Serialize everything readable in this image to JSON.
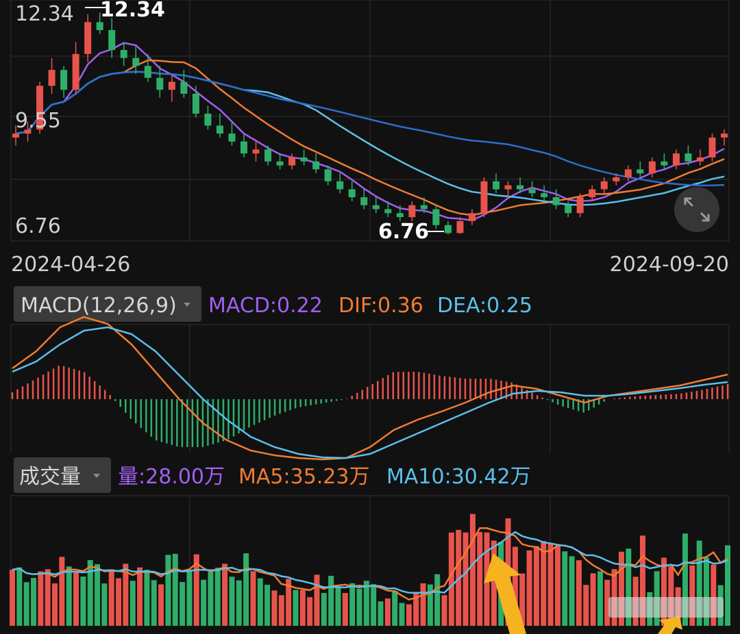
{
  "colors": {
    "background": "#111111",
    "grid": "#2e2e2e",
    "up": "#e8544c",
    "down": "#2fae6a",
    "ma_purple": "#a25ff0",
    "ma_orange": "#f07c32",
    "ma_lightblue": "#5bc0eb",
    "ma_blue": "#2a6fcf",
    "arrow": "#f5b31f",
    "label": "#d0d0d0"
  },
  "price_panel": {
    "y_labels": [
      "12.34",
      "9.55",
      "6.76"
    ],
    "max_marker": "12.34",
    "min_marker": "6.76",
    "date_start": "2024-04-26",
    "date_end": "2024-09-20",
    "expand_icon": "expand-arrows-icon"
  },
  "macd_panel": {
    "selector_label": "MACD(12,26,9)",
    "macd_text": "MACD:0.22",
    "dif_text": "DIF:0.36",
    "dea_text": "DEA:0.25"
  },
  "volume_panel": {
    "selector_label": "成交量",
    "vol_text": "量:28.00万",
    "ma5_text": "MA5:35.23万",
    "ma10_text": "MA10:30.42万"
  },
  "chart_data": [
    {
      "type": "candlestick",
      "title": "",
      "x_range": [
        "2024-04-26",
        "2024-09-20"
      ],
      "ylim": [
        6.76,
        12.34
      ],
      "high": 12.34,
      "low": 6.76,
      "ohlc": [
        [
          9.2,
          9.5,
          9.0,
          9.3
        ],
        [
          9.3,
          9.6,
          9.1,
          9.4
        ],
        [
          9.4,
          10.6,
          9.3,
          10.5
        ],
        [
          10.5,
          11.2,
          10.3,
          10.9
        ],
        [
          10.9,
          11.0,
          10.2,
          10.4
        ],
        [
          10.4,
          11.6,
          10.3,
          11.3
        ],
        [
          11.3,
          12.3,
          11.1,
          12.1
        ],
        [
          12.1,
          12.34,
          11.8,
          11.9
        ],
        [
          11.9,
          12.2,
          11.2,
          11.4
        ],
        [
          11.4,
          11.6,
          11.0,
          11.2
        ],
        [
          11.2,
          11.5,
          10.8,
          11.0
        ],
        [
          11.0,
          11.3,
          10.6,
          10.7
        ],
        [
          10.7,
          11.0,
          10.2,
          10.4
        ],
        [
          10.4,
          10.8,
          10.1,
          10.6
        ],
        [
          10.6,
          10.9,
          10.2,
          10.3
        ],
        [
          10.3,
          10.5,
          9.7,
          9.8
        ],
        [
          9.8,
          10.0,
          9.4,
          9.5
        ],
        [
          9.5,
          9.8,
          9.2,
          9.3
        ],
        [
          9.3,
          9.6,
          9.0,
          9.1
        ],
        [
          9.1,
          9.3,
          8.7,
          8.8
        ],
        [
          8.8,
          9.1,
          8.6,
          8.9
        ],
        [
          8.9,
          9.0,
          8.5,
          8.6
        ],
        [
          8.6,
          8.8,
          8.4,
          8.5
        ],
        [
          8.5,
          8.8,
          8.4,
          8.7
        ],
        [
          8.7,
          8.9,
          8.5,
          8.6
        ],
        [
          8.6,
          8.8,
          8.3,
          8.4
        ],
        [
          8.4,
          8.5,
          8.0,
          8.1
        ],
        [
          8.1,
          8.3,
          7.8,
          7.9
        ],
        [
          7.9,
          8.1,
          7.6,
          7.7
        ],
        [
          7.7,
          7.9,
          7.4,
          7.5
        ],
        [
          7.5,
          7.7,
          7.3,
          7.4
        ],
        [
          7.4,
          7.6,
          7.2,
          7.3
        ],
        [
          7.3,
          7.5,
          7.1,
          7.2
        ],
        [
          7.2,
          7.6,
          7.1,
          7.5
        ],
        [
          7.5,
          7.7,
          7.3,
          7.4
        ],
        [
          7.4,
          7.5,
          6.9,
          7.0
        ],
        [
          7.0,
          7.1,
          6.76,
          6.8
        ],
        [
          6.8,
          7.2,
          6.78,
          7.1
        ],
        [
          7.1,
          7.4,
          7.0,
          7.3
        ],
        [
          7.3,
          8.2,
          7.2,
          8.1
        ],
        [
          8.1,
          8.3,
          7.8,
          7.9
        ],
        [
          7.9,
          8.1,
          7.7,
          8.0
        ],
        [
          8.0,
          8.2,
          7.8,
          7.9
        ],
        [
          7.9,
          8.1,
          7.7,
          7.8
        ],
        [
          7.8,
          8.0,
          7.6,
          7.7
        ],
        [
          7.7,
          7.9,
          7.4,
          7.5
        ],
        [
          7.5,
          7.6,
          7.2,
          7.3
        ],
        [
          7.3,
          7.8,
          7.2,
          7.7
        ],
        [
          7.7,
          8.0,
          7.6,
          7.9
        ],
        [
          7.9,
          8.2,
          7.8,
          8.1
        ],
        [
          8.1,
          8.3,
          8.0,
          8.2
        ],
        [
          8.2,
          8.5,
          8.1,
          8.4
        ],
        [
          8.4,
          8.6,
          8.2,
          8.3
        ],
        [
          8.3,
          8.7,
          8.2,
          8.6
        ],
        [
          8.6,
          8.8,
          8.4,
          8.5
        ],
        [
          8.5,
          8.9,
          8.4,
          8.8
        ],
        [
          8.8,
          9.0,
          8.5,
          8.6
        ],
        [
          8.6,
          8.9,
          8.5,
          8.7
        ],
        [
          8.7,
          9.3,
          8.6,
          9.2
        ],
        [
          9.2,
          9.4,
          9.0,
          9.3
        ]
      ]
    },
    {
      "type": "line+bar",
      "title": "MACD(12,26,9)",
      "latest": {
        "MACD": 0.22,
        "DIF": 0.36,
        "DEA": 0.25
      },
      "series": [
        {
          "name": "DIF",
          "values": [
            0.45,
            0.7,
            1.05,
            1.2,
            1.1,
            0.8,
            0.4,
            0.0,
            -0.35,
            -0.6,
            -0.75,
            -0.82,
            -0.86,
            -0.88,
            -0.86,
            -0.7,
            -0.45,
            -0.3,
            -0.18,
            -0.05,
            0.1,
            0.2,
            0.15,
            0.05,
            -0.05,
            0.05,
            0.1,
            0.15,
            0.2,
            0.28,
            0.36
          ]
        },
        {
          "name": "DEA",
          "values": [
            0.4,
            0.55,
            0.8,
            1.0,
            1.05,
            0.95,
            0.7,
            0.35,
            0.0,
            -0.3,
            -0.55,
            -0.7,
            -0.8,
            -0.85,
            -0.86,
            -0.8,
            -0.65,
            -0.5,
            -0.35,
            -0.2,
            -0.05,
            0.08,
            0.12,
            0.1,
            0.05,
            0.05,
            0.08,
            0.12,
            0.16,
            0.21,
            0.25
          ]
        }
      ]
    },
    {
      "type": "bar+line",
      "title": "成交量",
      "unit": "万",
      "latest": {
        "量": 28.0,
        "MA5": 35.23,
        "MA10": 30.42
      }
    }
  ]
}
